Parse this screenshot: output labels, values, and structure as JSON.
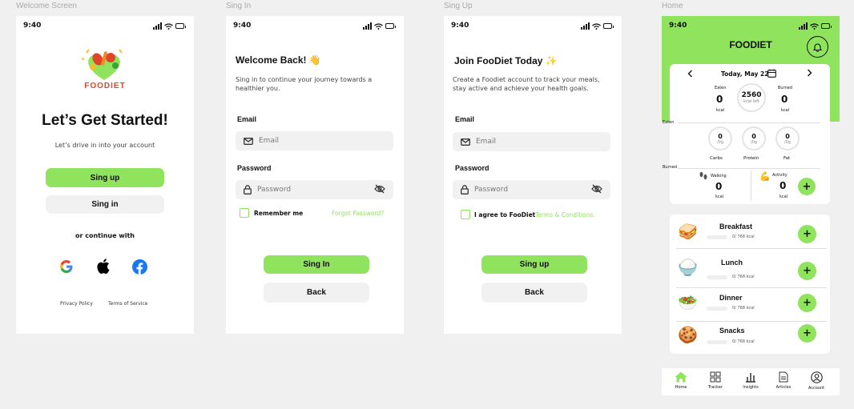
{
  "frames": {
    "welcome": "Welcome Screen",
    "signin": "Sing In",
    "signup": "Sing Up",
    "home": "Home"
  },
  "status_time": "9:40",
  "welcome": {
    "brand": "FOODIET",
    "title": "Let’s Get Started!",
    "subtitle": "Let’s drive in into your account",
    "signup_btn": "Sing up",
    "signin_btn": "Sing in",
    "continue_with": "or continue with",
    "privacy": "Privacy Policy",
    "terms": "Terms of Service"
  },
  "signin": {
    "title": "Welcome Back! 👋",
    "subtitle": "Sing in to continue your journey towards a healthier you.",
    "email_label": "Email",
    "email_placeholder": "Email",
    "password_label": "Password",
    "password_placeholder": "Password",
    "remember": "Remember me",
    "forgot": "Forgot Password?",
    "signin_btn": "Sing In",
    "back_btn": "Back"
  },
  "signup": {
    "title": "Join FooDiet Today ✨",
    "subtitle": "Create a Foodiet account to track your meals, stay active and achieve your health goals.",
    "email_label": "Email",
    "email_placeholder": "Email",
    "password_label": "Password",
    "password_placeholder": "Password",
    "agree": "I agree to FooDiet",
    "terms": "Terms & Conditions.",
    "signup_btn": "Sing up",
    "back_btn": "Back"
  },
  "home": {
    "brand": "FOODIET",
    "date": "Today, May 22",
    "eaten_label": "Eaten",
    "eaten_value": "0",
    "burned_label": "Burned",
    "burned_value": "0",
    "kcal": "kcal",
    "center_value": "2560",
    "center_sub": "kcal left",
    "section_eaten": "Eaten",
    "section_burned": "Burned",
    "macros": [
      {
        "name": "Carbs",
        "value": "0",
        "unit": "/0g"
      },
      {
        "name": "Protein",
        "value": "0",
        "unit": "/0g"
      },
      {
        "name": "Fat",
        "value": "0",
        "unit": "/0g"
      }
    ],
    "walking_label": "Walking",
    "walking_value": "0",
    "activity_label": "Activity",
    "activity_value": "0",
    "meals": [
      {
        "name": "Breakfast",
        "kcal": "0/ 768 kcal",
        "emoji": "🥪"
      },
      {
        "name": "Lunch",
        "kcal": "0/ 768 kcal",
        "emoji": "🍚"
      },
      {
        "name": "Dinner",
        "kcal": "0/ 768 kcal",
        "emoji": "🥗"
      },
      {
        "name": "Snacks",
        "kcal": "0/ 768 kcal",
        "emoji": "🍪"
      }
    ],
    "nav": [
      "Home",
      "Tracker",
      "Insights",
      "Articles",
      "Account"
    ]
  },
  "colors": {
    "accent": "#8fe35d",
    "brand_red": "#e0452a"
  }
}
